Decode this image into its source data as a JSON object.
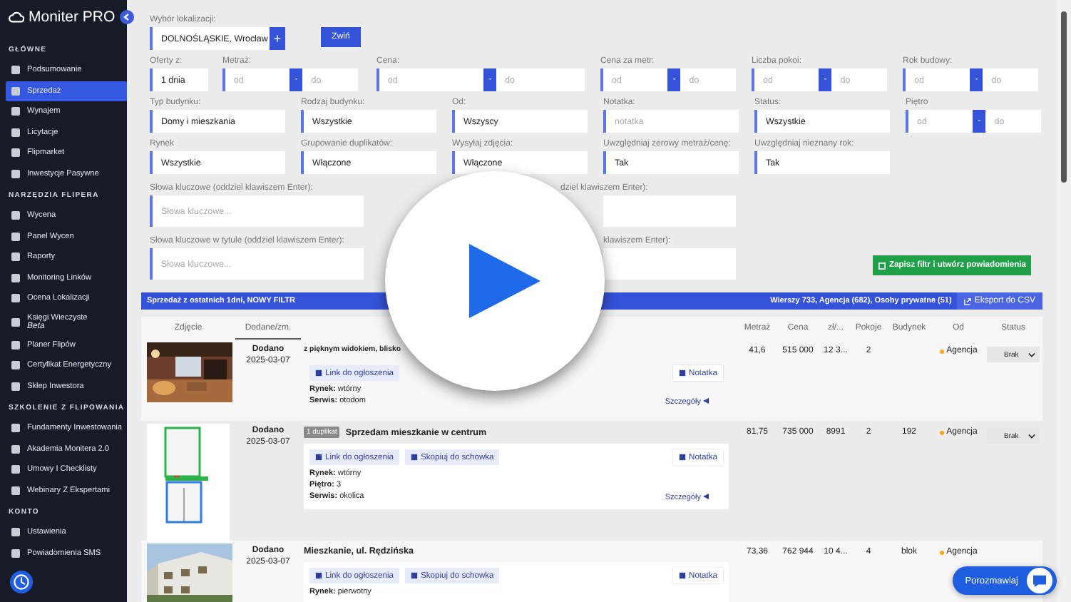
{
  "sidebar": {
    "logo": "Moniter PRO",
    "sections": [
      {
        "title": "GŁÓWNE",
        "items": [
          {
            "label": "Podsumowanie",
            "selected": false
          },
          {
            "label": "Sprzedaż",
            "selected": true
          },
          {
            "label": "Wynajem",
            "selected": false
          },
          {
            "label": "Licytacje",
            "selected": false
          },
          {
            "label": "Flipmarket",
            "selected": false
          },
          {
            "label": "Inwestycje Pasywne",
            "selected": false
          }
        ]
      },
      {
        "title": "NARZĘDZIA FLIPERA",
        "items": [
          {
            "label": "Wycena",
            "selected": false
          },
          {
            "label": "Panel Wycen",
            "selected": false
          },
          {
            "label": "Raporty",
            "selected": false
          },
          {
            "label": "Monitoring Linków",
            "selected": false
          },
          {
            "label": "Ocena Lokalizacji",
            "selected": false
          },
          {
            "label": "Księgi Wieczyste",
            "note": "Beta",
            "selected": false
          },
          {
            "label": "Planer Flipów",
            "selected": false
          },
          {
            "label": "Certyfikat Energetyczny",
            "selected": false
          },
          {
            "label": "Sklep Inwestora",
            "selected": false
          }
        ]
      },
      {
        "title": "SZKOLENIE Z FLIPOWANIA",
        "items": [
          {
            "label": "Fundamenty Inwestowania",
            "selected": false
          },
          {
            "label": "Akademia Monitera 2.0",
            "selected": false
          },
          {
            "label": "Umowy I Checklisty",
            "selected": false
          },
          {
            "label": "Webinary Z Ekspertami",
            "selected": false
          }
        ]
      },
      {
        "title": "KONTO",
        "items": [
          {
            "label": "Ustawienia",
            "selected": false
          },
          {
            "label": "Powiadomienia SMS",
            "selected": false
          }
        ]
      }
    ]
  },
  "location": {
    "label": "Wybór lokalizacji:",
    "value": "DOLNOŚLĄSKIE, Wrocław",
    "add": "+"
  },
  "collapse_button": "Zwiń",
  "filter_rows": [
    [
      {
        "kind": "select",
        "label": "Oferty z:",
        "value": "1 dnia"
      },
      {
        "kind": "range",
        "label": "Metraż:",
        "from": "od",
        "sep": "-",
        "to": "do"
      },
      {
        "kind": "range",
        "label": "Cena:",
        "from": "od",
        "sep": "-",
        "to": "do"
      },
      {
        "kind": "range",
        "label": "Cena za metr:",
        "from": "od",
        "sep": "-",
        "to": "do"
      },
      {
        "kind": "range",
        "label": "Liczba pokoi:",
        "from": "od",
        "sep": "-",
        "to": "do"
      },
      {
        "kind": "range",
        "label": "Rok budowy:",
        "from": "od",
        "sep": "-",
        "to": "do"
      }
    ],
    [
      {
        "kind": "select",
        "label": "Typ budynku:",
        "value": "Domy i mieszkania"
      },
      {
        "kind": "select",
        "label": "Rodzaj budynku:",
        "value": "Wszystkie"
      },
      {
        "kind": "select",
        "label": "Od:",
        "value": "Wszyscy"
      },
      {
        "kind": "input",
        "label": "Notatka:",
        "placeholder": "notatka"
      },
      {
        "kind": "select",
        "label": "Status:",
        "value": "Wszystkie"
      },
      {
        "kind": "range",
        "label": "Piętro",
        "from": "od",
        "sep": "-",
        "to": "do"
      }
    ],
    [
      {
        "kind": "select",
        "label": "Rynek",
        "value": "Wszystkie"
      },
      {
        "kind": "select",
        "label": "Grupowanie duplikatów:",
        "value": "Włączone"
      },
      {
        "kind": "select",
        "label": "Wysyłaj zdjęcia:",
        "value": "Włączone"
      },
      {
        "kind": "select",
        "label": "Uwzględniaj zerowy metraż/cenę:",
        "value": "Tak"
      },
      {
        "kind": "select",
        "label": "Uwzględniaj nieznany rok:",
        "value": "Tak"
      }
    ]
  ],
  "keyword_rows": [
    {
      "left": {
        "label": "Słowa kluczowe (oddziel klawiszem Enter):",
        "placeholder": "Słowa kluczowe..."
      },
      "right": {
        "label": "dziel klawiszem Enter):"
      }
    },
    {
      "left": {
        "label": "Słowa kluczowe w tytule (oddziel klawiszem Enter):",
        "placeholder": "Słowa kluczowe..."
      },
      "right": {
        "label": "klawiszem Enter):"
      }
    }
  ],
  "save_button": "Zapisz filtr i utwórz powiadomienia",
  "summary_bar": {
    "title": "Sprzedaż z ostatnich 1dni, NOWY FILTR",
    "counts": "Wierszy 733, Agencja (682), Osoby prywatne (51)",
    "export": "Eksport do CSV"
  },
  "table": {
    "leading_columns": [
      {
        "label": "Zdjęcie",
        "selected": false
      },
      {
        "label": "Dodane/zm.",
        "selected": true
      }
    ],
    "columns": [
      {
        "label": "Metraż",
        "selected": false
      },
      {
        "label": "Cena",
        "selected": false
      },
      {
        "label": "zł/...",
        "selected": false
      },
      {
        "label": "Pokoje",
        "selected": false
      },
      {
        "label": "Budynek",
        "selected": false
      },
      {
        "label": "Od",
        "selected": false
      },
      {
        "label": "Status",
        "selected": false
      }
    ],
    "rows": [
      {
        "photo": {
          "kind": "picture"
        },
        "added": "Dodano",
        "date": "2025-03-07",
        "title": "z pięknym widokiem, blisko",
        "buttons": [
          "Link do ogłoszenia"
        ],
        "note_button": "Notatka",
        "details": [
          "**Rynek:** wtórny",
          "**Serwis:** otodom"
        ],
        "more": "Szczegóły",
        "cells": [
          "41,6",
          "515 000",
          "12 3...",
          "2",
          ""
        ],
        "source": "Agencja",
        "status": "Brak"
      },
      {
        "photo": {
          "kind": "floor_plan"
        },
        "added": "Dodano",
        "date": "2025-03-07",
        "badge": "1 duplikat",
        "title": "Sprzedam mieszkanie w centrum",
        "buttons": [
          "Link do ogłoszenia",
          "Skopiuj do schowka"
        ],
        "note_button": "Notatka",
        "details": [
          "**Rynek:** wtórny",
          "**Piętro:** 3",
          "**Serwis:** okolica"
        ],
        "more": "Szczegóły",
        "cells": [
          "81,75",
          "735 000",
          "8991",
          "2",
          "192"
        ],
        "source": "Agencja",
        "status": "Brak"
      },
      {
        "photo": {
          "kind": "picture"
        },
        "added": "Dodano",
        "date": "2025-03-07",
        "title": "Mieszkanie, ul. Rędzińska",
        "buttons": [
          "Link do ogłoszenia",
          "Skopiuj do schowka"
        ],
        "note_button": "Notatka",
        "details": [
          "**Rynek:** pierwotny"
        ],
        "cells": [
          "73,36",
          "762 944",
          "10 4...",
          "4",
          "blok"
        ],
        "source": "Agencja"
      }
    ]
  },
  "chat_button": "Porozmawiaj"
}
